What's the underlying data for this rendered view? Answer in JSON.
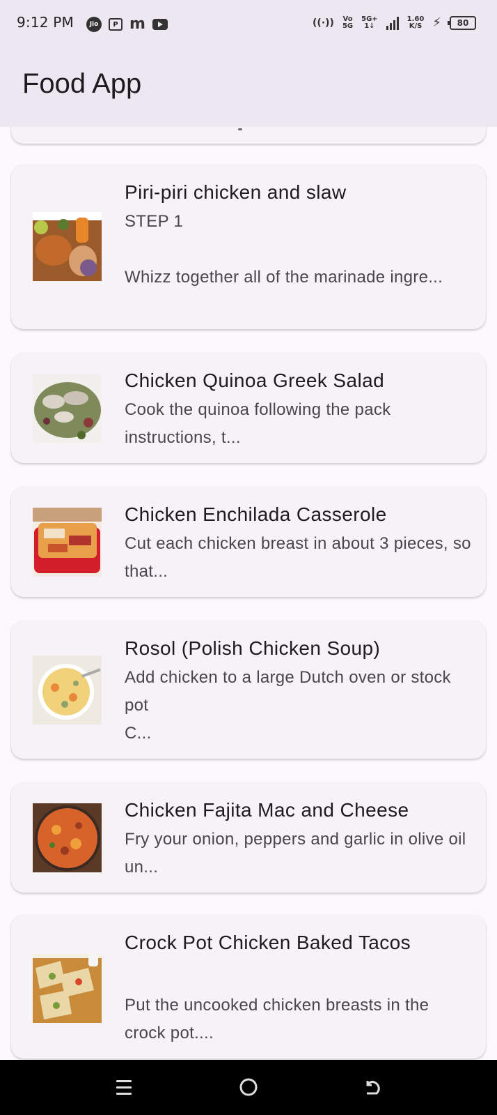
{
  "status_bar": {
    "time": "9:12 PM",
    "left_icons": [
      "jio-icon",
      "paytm-icon",
      "m-icon",
      "youtube-icon"
    ],
    "jio_label": "Jio",
    "hotspot": "((·))",
    "volte_top": "Vo",
    "volte_bottom": "5G",
    "net_top": "5G+",
    "net_bottom": "1↓",
    "speed_value": "1.60",
    "speed_unit": "K/S",
    "battery": "80"
  },
  "app_bar": {
    "title": "Food App"
  },
  "recipes": [
    {
      "title": "Piri-piri chicken and slaw",
      "description": "STEP 1\n\nWhizz together all of the marinade ingre...",
      "thumb_colors": [
        "#7a3d1b",
        "#c26a2c",
        "#e8b56a",
        "#5a7b2e"
      ]
    },
    {
      "title": "Chicken Quinoa Greek Salad",
      "description": "Cook the quinoa following the pack instructions, t...",
      "thumb_colors": [
        "#f2f0ec",
        "#6b7a3a",
        "#8b5a4a",
        "#c9c2b5"
      ]
    },
    {
      "title": "Chicken Enchilada Casserole",
      "description": "Cut each chicken breast in about 3 pieces, so that...",
      "thumb_colors": [
        "#d21f2b",
        "#e8a14a",
        "#f3e2c8",
        "#b0342a"
      ]
    },
    {
      "title": "Rosol (Polish Chicken Soup)",
      "description": "Add chicken to a large Dutch oven or stock pot\nC...",
      "thumb_colors": [
        "#f4f1e8",
        "#f1d27a",
        "#e8893a",
        "#8ea26a"
      ]
    },
    {
      "title": "Chicken Fajita Mac and Cheese",
      "description": "Fry your onion, peppers and garlic in olive oil un...",
      "thumb_colors": [
        "#3b2a22",
        "#d8632a",
        "#f0a03a",
        "#9a3b1f"
      ]
    },
    {
      "title": "Crock Pot Chicken Baked Tacos",
      "description": "Put the uncooked chicken breasts in the crock pot....",
      "thumb_colors": [
        "#e9d7a8",
        "#c78b3a",
        "#7a9b3a",
        "#f5f0e1"
      ]
    }
  ],
  "nav_bar": {
    "icons": [
      "menu-icon",
      "home-icon",
      "back-icon"
    ]
  }
}
